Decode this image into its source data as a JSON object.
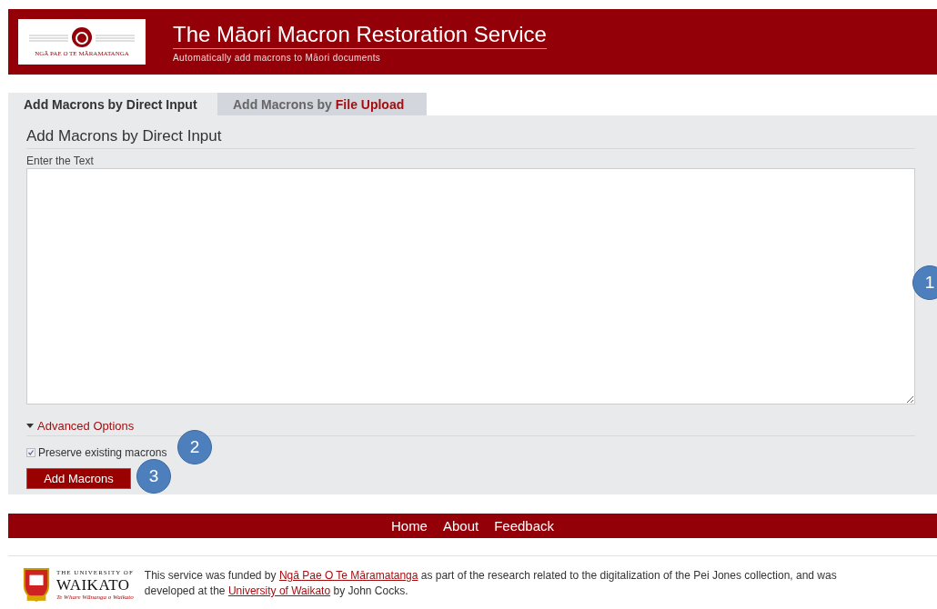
{
  "header": {
    "logo_text": "NGĀ PAE O TE MĀRAMATANGA",
    "title": "The Māori Macron Restoration Service",
    "subtitle": "Automatically add macrons to Māori documents"
  },
  "tabs": [
    {
      "prefix": "Add Macrons by",
      "emphasis": "Direct Input",
      "selected": true
    },
    {
      "prefix": "Add Macrons by",
      "emphasis": "File Upload",
      "selected": false
    }
  ],
  "panel": {
    "heading": "Add Macrons by Direct Input",
    "text_label": "Enter the Text",
    "advanced": {
      "label": "Advanced Options",
      "expanded": true
    },
    "options": [
      {
        "label": "Preserve existing macrons",
        "checked": true
      }
    ],
    "submit": "Add Macrons"
  },
  "callouts": [
    "1",
    "2",
    "3"
  ],
  "nav": [
    "Home",
    "About",
    "Feedback"
  ],
  "footer": {
    "logo": {
      "line1": "THE UNIVERSITY OF",
      "line2": "WAIKATO",
      "line3": "Te Whare Wānanga o Waikato"
    },
    "segments": [
      {
        "kind": "text",
        "text": "This service was funded by "
      },
      {
        "kind": "link",
        "text": "Ngā Pae O Te Māramatanga"
      },
      {
        "kind": "text",
        "text": " as part of the research related to the digitalization of the Pei Jones collection, and was developed at the "
      },
      {
        "kind": "link",
        "text": "University of Waikato"
      },
      {
        "kind": "text",
        "text": " by John Cocks."
      }
    ]
  }
}
